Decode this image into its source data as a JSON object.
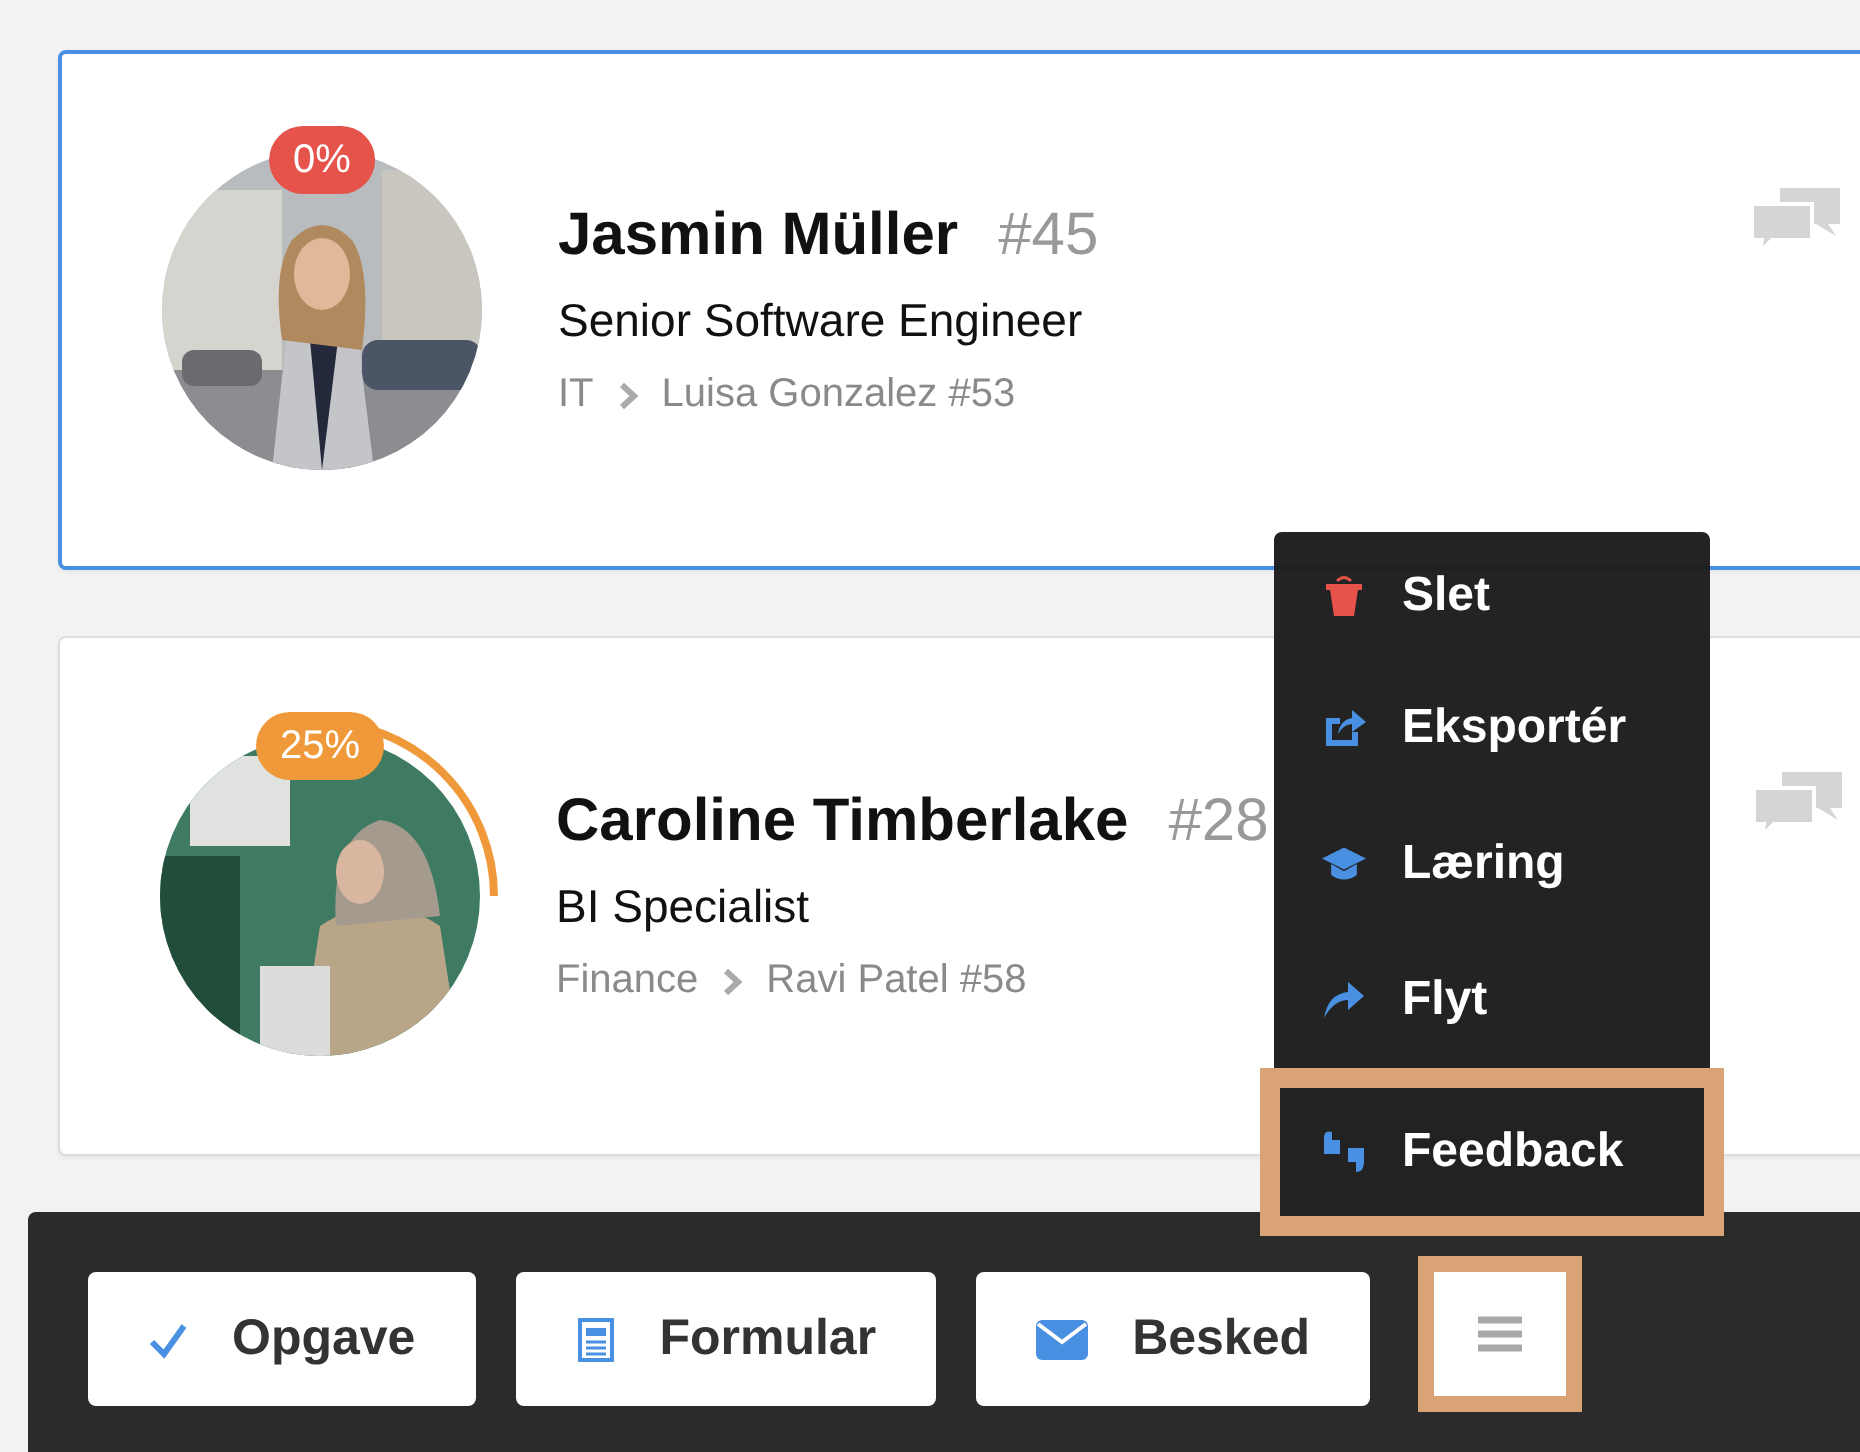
{
  "cards": [
    {
      "name": "Jasmin Müller",
      "number": "#45",
      "title": "Senior Software Engineer",
      "department": "IT",
      "manager": "Luisa Gonzalez #53",
      "progress": "0%",
      "color": "#e5534b",
      "focused": true
    },
    {
      "name": "Caroline Timberlake",
      "number": "#28",
      "title": "BI Specialist",
      "department": "Finance",
      "manager": "Ravi Patel #58",
      "progress": "25%",
      "level": 0.25,
      "color": "#f0993a",
      "focused": false
    }
  ],
  "menu": {
    "items": [
      {
        "label": "Slet",
        "kind": "delete",
        "highlighted": false
      },
      {
        "label": "Eksportér",
        "kind": "export",
        "highlighted": false
      },
      {
        "label": "Læring",
        "kind": "learning",
        "highlighted": false
      },
      {
        "label": "Flyt",
        "kind": "move",
        "highlighted": false
      },
      {
        "label": "Feedback",
        "kind": "feedback",
        "highlighted": true
      }
    ]
  },
  "toolbar": {
    "buttons": [
      {
        "label": "Opgave",
        "kind": "task"
      },
      {
        "label": "Formular",
        "kind": "form"
      },
      {
        "label": "Besked",
        "kind": "message"
      }
    ],
    "menu_button": {
      "highlighted": true
    }
  }
}
